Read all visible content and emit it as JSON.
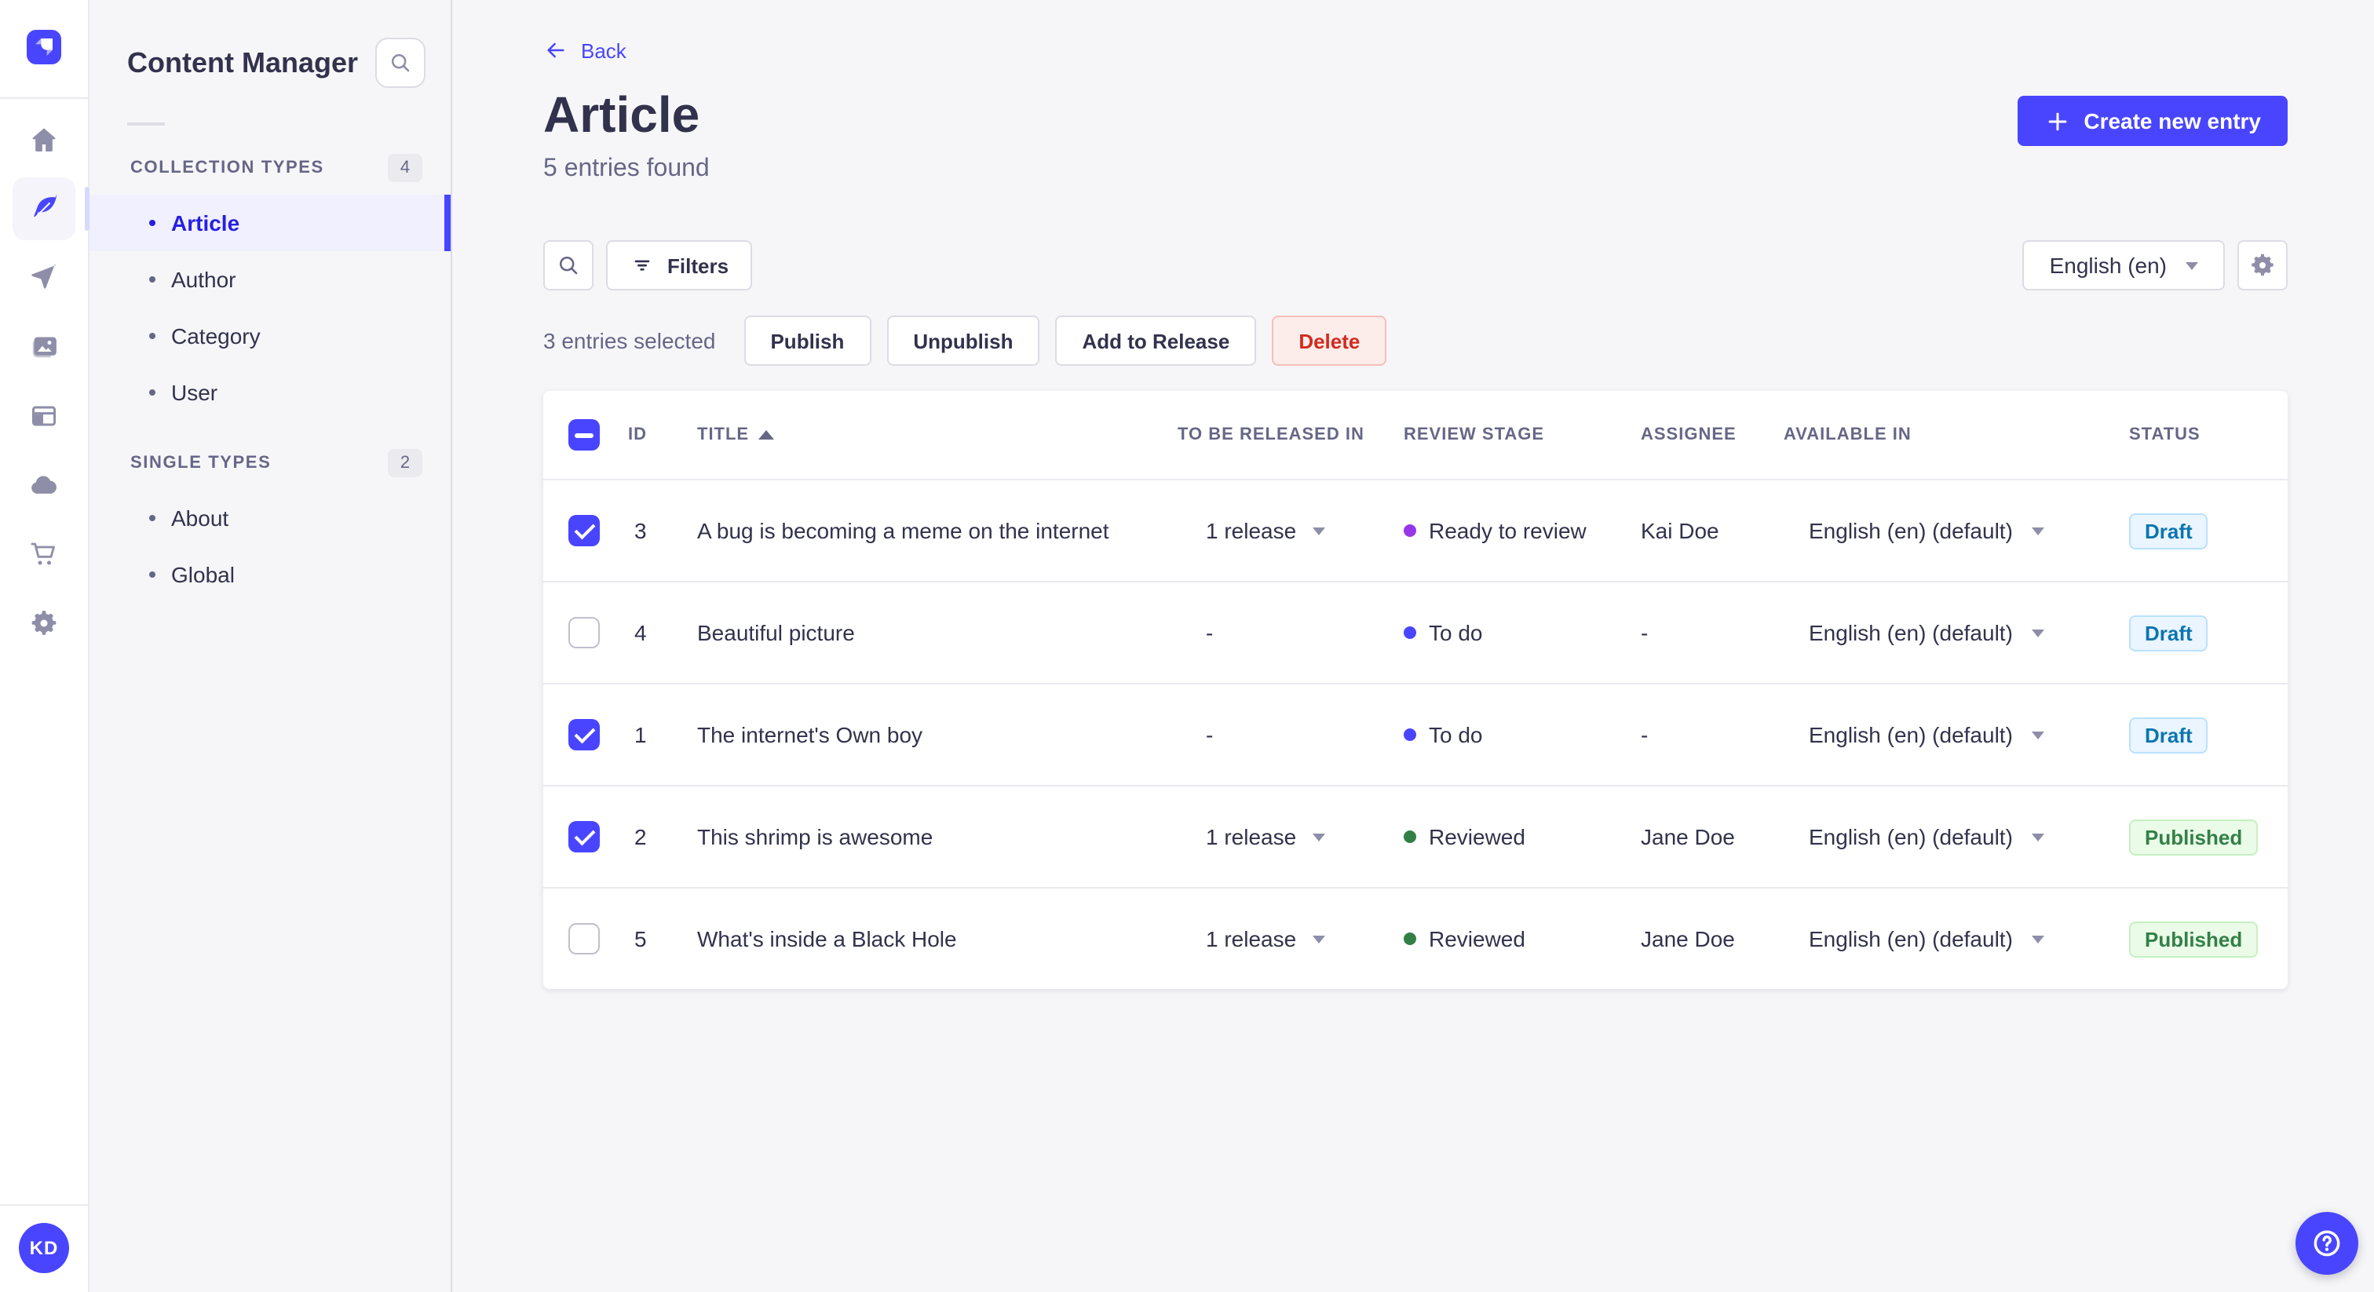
{
  "brand": {
    "primary_color": "#4945ff",
    "active_link_color": "#271fe0"
  },
  "rail": {
    "logo_icon": "strapi-logo",
    "icons": [
      {
        "name": "home-icon",
        "active": false
      },
      {
        "name": "content-manager-feather-icon",
        "active": true
      },
      {
        "name": "releases-paper-plane-icon",
        "active": false
      },
      {
        "name": "media-library-icon",
        "active": false
      },
      {
        "name": "content-type-builder-icon",
        "active": false
      },
      {
        "name": "deploy-cloud-icon",
        "active": false
      },
      {
        "name": "marketplace-cart-icon",
        "active": false
      },
      {
        "name": "settings-gear-icon",
        "active": false
      }
    ]
  },
  "user": {
    "initials": "KD"
  },
  "subnav": {
    "title": "Content Manager",
    "search_icon": "search-icon",
    "sections": [
      {
        "label": "COLLECTION TYPES",
        "count": "4",
        "items": [
          {
            "label": "Article",
            "active": true
          },
          {
            "label": "Author",
            "active": false
          },
          {
            "label": "Category",
            "active": false
          },
          {
            "label": "User",
            "active": false
          }
        ]
      },
      {
        "label": "SINGLE TYPES",
        "count": "2",
        "items": [
          {
            "label": "About",
            "active": false
          },
          {
            "label": "Global",
            "active": false
          }
        ]
      }
    ]
  },
  "header": {
    "back": "Back",
    "title": "Article",
    "subtitle": "5 entries found",
    "create_label": "Create new entry"
  },
  "toolbar": {
    "filters_label": "Filters",
    "locale_label": "English (en)",
    "settings_icon": "gear-icon"
  },
  "selection": {
    "count_text": "3 entries selected",
    "publish": "Publish",
    "unpublish": "Unpublish",
    "add_to_release": "Add to Release",
    "delete": "Delete"
  },
  "table": {
    "headers": {
      "id": "ID",
      "title": "TITLE",
      "release": "TO BE RELEASED IN",
      "stage": "REVIEW STAGE",
      "assignee": "ASSIGNEE",
      "available": "AVAILABLE IN",
      "status": "STATUS"
    },
    "sort": {
      "column": "TITLE",
      "direction": "ascending"
    },
    "stage_colors": {
      "Ready to review": "#9736e8",
      "To do": "#4945ff",
      "Reviewed": "#328048"
    },
    "status_colors": {
      "Draft": "#0c75af",
      "Published": "#328048"
    },
    "rows": [
      {
        "selected": true,
        "id": "3",
        "title": "A bug is becoming a meme on the internet",
        "release": "1 release",
        "stage": "Ready to review",
        "assignee": "Kai Doe",
        "locale": "English (en) (default)",
        "status": "Draft"
      },
      {
        "selected": false,
        "id": "4",
        "title": "Beautiful picture",
        "release": "-",
        "stage": "To do",
        "assignee": "-",
        "locale": "English (en) (default)",
        "status": "Draft"
      },
      {
        "selected": true,
        "id": "1",
        "title": "The internet's Own boy",
        "release": "-",
        "stage": "To do",
        "assignee": "-",
        "locale": "English (en) (default)",
        "status": "Draft"
      },
      {
        "selected": true,
        "id": "2",
        "title": "This shrimp is awesome",
        "release": "1 release",
        "stage": "Reviewed",
        "assignee": "Jane Doe",
        "locale": "English (en) (default)",
        "status": "Published"
      },
      {
        "selected": false,
        "id": "5",
        "title": "What's inside a Black Hole",
        "release": "1 release",
        "stage": "Reviewed",
        "assignee": "Jane Doe",
        "locale": "English (en) (default)",
        "status": "Published"
      }
    ]
  },
  "help": {
    "icon": "question-mark-icon"
  }
}
